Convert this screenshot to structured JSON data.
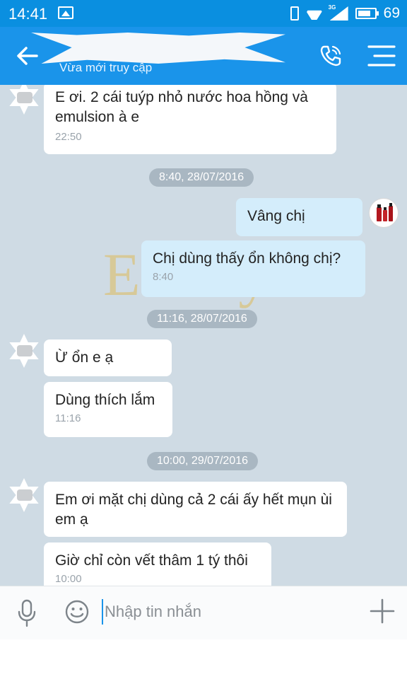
{
  "status_bar": {
    "time": "14:41",
    "network_label": "3G",
    "battery": "69",
    "icons": [
      "image-icon",
      "vibrate-icon",
      "wifi-icon",
      "signal-icon",
      "battery-icon"
    ]
  },
  "header": {
    "subtitle": "Vừa mới truy cập",
    "icons": [
      "back-arrow-icon",
      "phone-call-icon",
      "menu-icon"
    ],
    "background": "#1a94ea"
  },
  "chat": {
    "background": "#cfdbe4",
    "messages": [
      {
        "side": "in",
        "text": "E ơi. 2 cái  tuýp nhỏ nước hoa hồng và emulsion  à e",
        "time": "22:50"
      },
      {
        "side": "out",
        "text": "Vâng chị",
        "time": ""
      },
      {
        "side": "out",
        "text": "Chị dùng thấy ổn không chị?",
        "time": "8:40"
      },
      {
        "side": "in",
        "text": "Ừ ổn e ạ",
        "time": ""
      },
      {
        "side": "in",
        "text": "Dùng thích lắm",
        "time": "11:16"
      },
      {
        "side": "in",
        "text": "Em ơi mặt chị dùng cả 2 cái ấy hết mụn ùi em ạ",
        "time": ""
      },
      {
        "side": "in",
        "text": "Giờ chỉ còn vết thâm 1 tý thôi",
        "time": "10:00"
      }
    ],
    "dates": [
      "8:40, 28/07/2016",
      "11:16, 28/07/2016",
      "10:00, 29/07/2016"
    ],
    "watermark": {
      "main": "Edally",
      "sup": "EX"
    }
  },
  "input_bar": {
    "placeholder": "Nhập tin nhắn",
    "icons": [
      "mic-icon",
      "emoji-icon",
      "plus-icon"
    ]
  }
}
